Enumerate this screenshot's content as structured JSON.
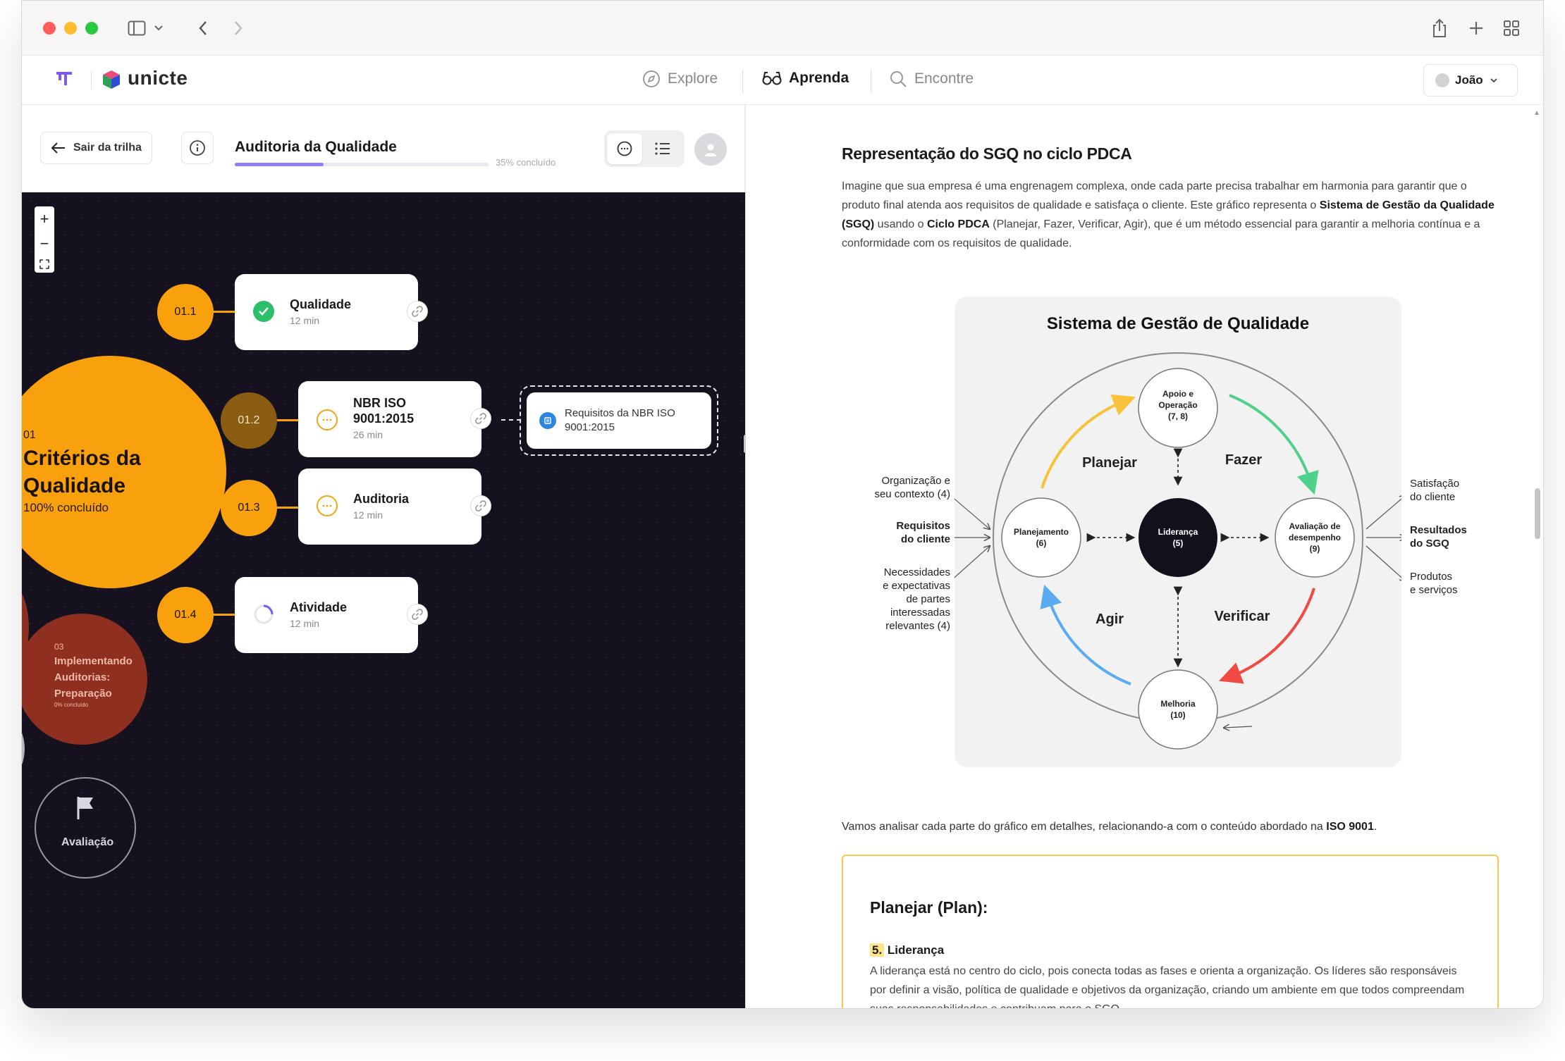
{
  "app": {
    "brand": "unicte",
    "nav": [
      {
        "label": "Explore",
        "icon": "compass-icon",
        "active": false
      },
      {
        "label": "Aprenda",
        "icon": "glasses-icon",
        "active": true
      },
      {
        "label": "Encontre",
        "icon": "search-icon",
        "active": false
      }
    ],
    "user": "João"
  },
  "trail": {
    "exit_label": "Sair da trilha",
    "course_title": "Auditoria da Qualidade",
    "progress_percent": 35,
    "progress_text": "35% concluído"
  },
  "canvas": {
    "main": {
      "code": "01",
      "title_line1": "Critérios da",
      "title_line2": "Qualidade",
      "status": "100% concluído"
    },
    "secondary": {
      "code": "03",
      "title_line1": "Implementando",
      "title_line2": "Auditorias:",
      "title_line3": "Preparação",
      "status": "0% concluído"
    },
    "evaluation": "Avaliação",
    "lessons": [
      {
        "code": "01.1",
        "title": "Qualidade",
        "duration": "12 min",
        "status": "done"
      },
      {
        "code": "01.2",
        "title_line1": "NBR ISO",
        "title_line2": "9001:2015",
        "duration": "26 min",
        "status": "pending"
      },
      {
        "code": "01.3",
        "title": "Auditoria",
        "duration": "12 min",
        "status": "pending"
      },
      {
        "code": "01.4",
        "title": "Atividade",
        "duration": "12 min",
        "status": "in-progress"
      }
    ],
    "attachment": {
      "line1": "Requisitos da NBR ISO",
      "line2": "9001:2015"
    }
  },
  "content": {
    "title": "Representação do SGQ no ciclo PDCA",
    "intro_part1": "Imagine que sua empresa é uma engrenagem complexa, onde cada parte precisa trabalhar em harmonia para garantir que o produto final atenda aos requisitos de qualidade e satisfaça o cliente. Este gráfico representa o ",
    "intro_bold1": "Sistema de Gestão da Qualidade (SGQ)",
    "intro_part2": " usando o ",
    "intro_bold2": "Ciclo PDCA",
    "intro_part3": " (Planejar, Fazer, Verificar, Agir), que é um método essencial para garantir a melhoria contínua e a conformidade com os requisitos de qualidade.",
    "diagram": {
      "title": "Sistema de Gestão de Qualidade",
      "center_line1": "Liderança",
      "center_line2": "(5)",
      "top_line1": "Apoio e",
      "top_line2": "Operação",
      "top_line3": "(7, 8)",
      "left_line1": "Planejamento",
      "left_line2": "(6)",
      "right_line1": "Avaliação de",
      "right_line2": "desempenho",
      "right_line3": "(9)",
      "bottom_line1": "Melhoria",
      "bottom_line2": "(10)",
      "plan": "Planejar",
      "do": "Fazer",
      "check": "Verificar",
      "act": "Agir",
      "in1_line1": "Organização e",
      "in1_line2": "seu contexto (4)",
      "in2_line1": "Requisitos",
      "in2_line2": "do cliente",
      "in3_line1": "Necessidades",
      "in3_line2": "e expectativas",
      "in3_line3": "de partes",
      "in3_line4": "interessadas",
      "in3_line5": "relevantes (4)",
      "out1_line1": "Satisfação",
      "out1_line2": "do cliente",
      "out2_line1": "Resultados",
      "out2_line2": "do SGQ",
      "out3_line1": "Produtos",
      "out3_line2": "e serviços",
      "colors": {
        "plan": "#f8c33a",
        "do": "#4fd18b",
        "check": "#f04a42",
        "act": "#5aabf2"
      }
    },
    "analysis_part1": "Vamos analisar cada parte do gráfico em detalhes, relacionando-a com o conteúdo abordado na ",
    "analysis_bold": "ISO 9001",
    "analysis_part2": ".",
    "plan_section": {
      "title": "Planejar (Plan):",
      "item_number": "5.",
      "item_title": " Liderança",
      "body": "A liderança está no centro do ciclo, pois conecta todas as fases e orienta a organização. Os líderes são responsáveis por definir a visão, política de qualidade e objetivos da organização, criando um ambiente em que todos compreendam suas responsabilidades e contribuam para o SGQ."
    }
  }
}
